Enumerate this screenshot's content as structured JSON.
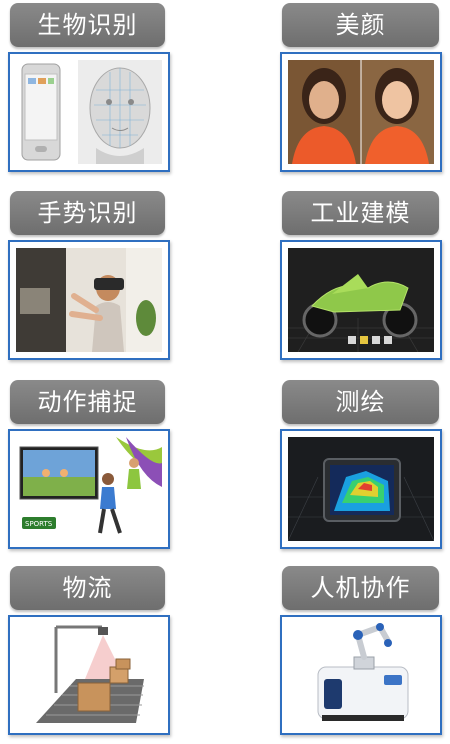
{
  "tiles": [
    {
      "label": "生物识别",
      "image": "phone-and-face-mesh"
    },
    {
      "label": "美颜",
      "image": "woman-before-after-beauty"
    },
    {
      "label": "手势识别",
      "image": "woman-with-vr-headset"
    },
    {
      "label": "工业建模",
      "image": "motorcycle-3d-model"
    },
    {
      "label": "动作捕捉",
      "image": "kids-playing-motion-game"
    },
    {
      "label": "测绘",
      "image": "tablet-3d-depth-map"
    },
    {
      "label": "物流",
      "image": "conveyor-with-boxes"
    },
    {
      "label": "人机协作",
      "image": "robot-arm-on-mobile-base"
    }
  ],
  "badge": {
    "text": "SPORTS"
  }
}
